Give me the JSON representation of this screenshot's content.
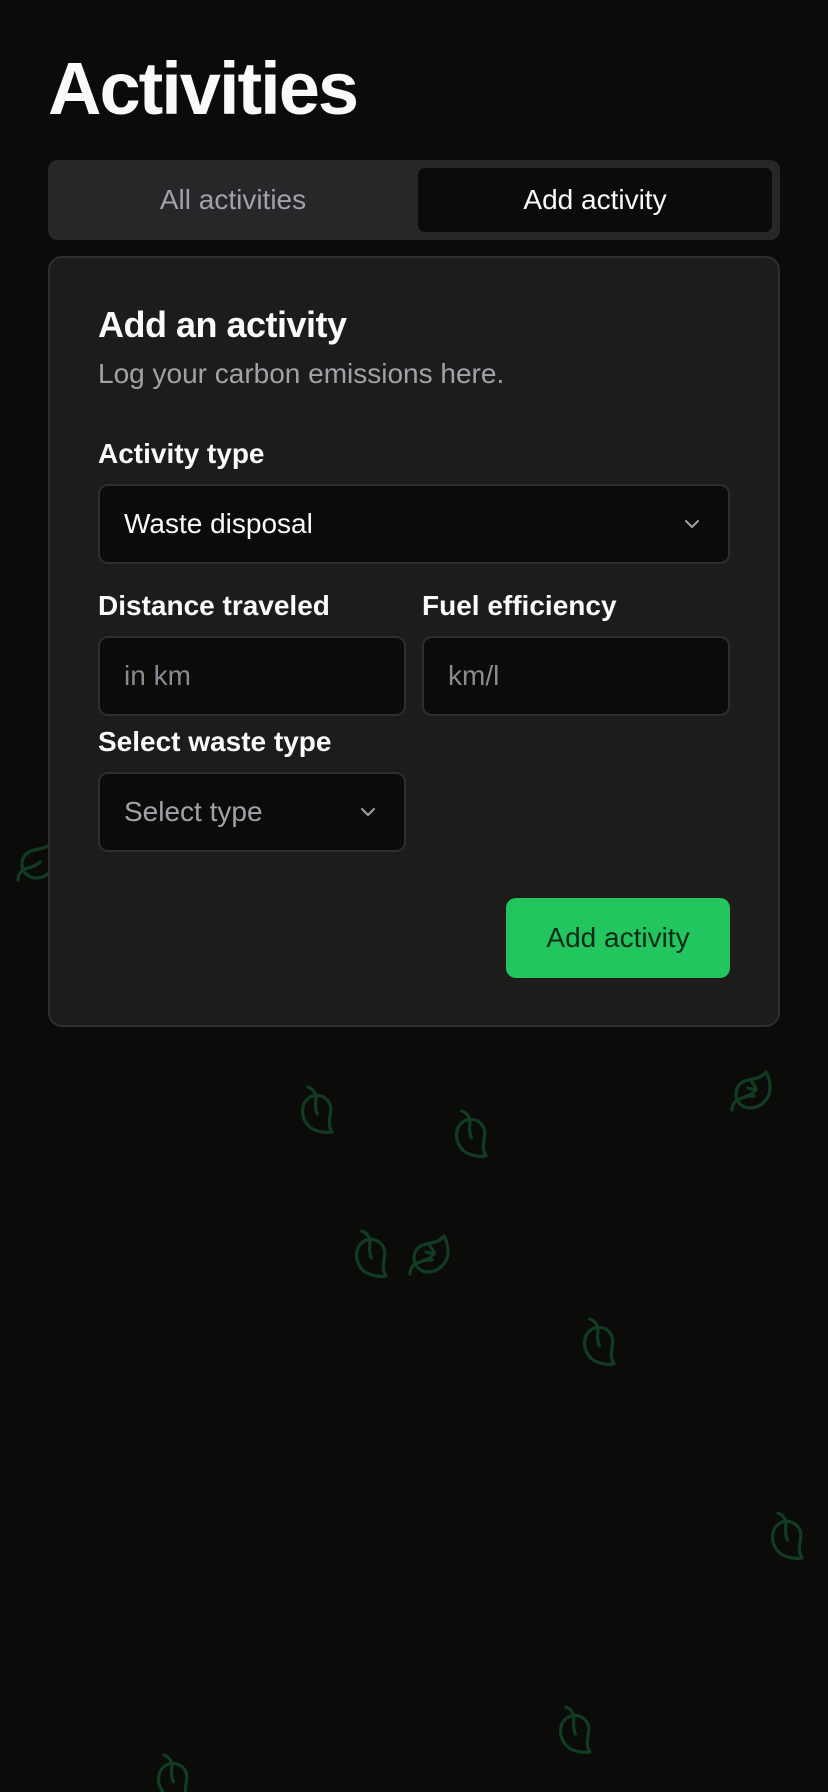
{
  "page": {
    "title": "Activities"
  },
  "tabs": [
    {
      "label": "All activities",
      "active": false
    },
    {
      "label": "Add activity",
      "active": true
    }
  ],
  "form": {
    "title": "Add an activity",
    "subtitle": "Log your carbon emissions here.",
    "activity_type": {
      "label": "Activity type",
      "value": "Waste disposal"
    },
    "distance": {
      "label": "Distance traveled",
      "placeholder": "in km",
      "value": ""
    },
    "fuel": {
      "label": "Fuel efficiency",
      "placeholder": "km/l",
      "value": ""
    },
    "waste_type": {
      "label": "Select waste type",
      "placeholder": "Select type"
    },
    "submit_label": "Add activity"
  },
  "colors": {
    "background": "#0b0b0a",
    "card": "#1c1c1b",
    "accent": "#22c55e",
    "leaf": "#166534"
  },
  "icons": {
    "dropdown": "chevron-down-icon",
    "background_leaf": "leaf-icon"
  }
}
